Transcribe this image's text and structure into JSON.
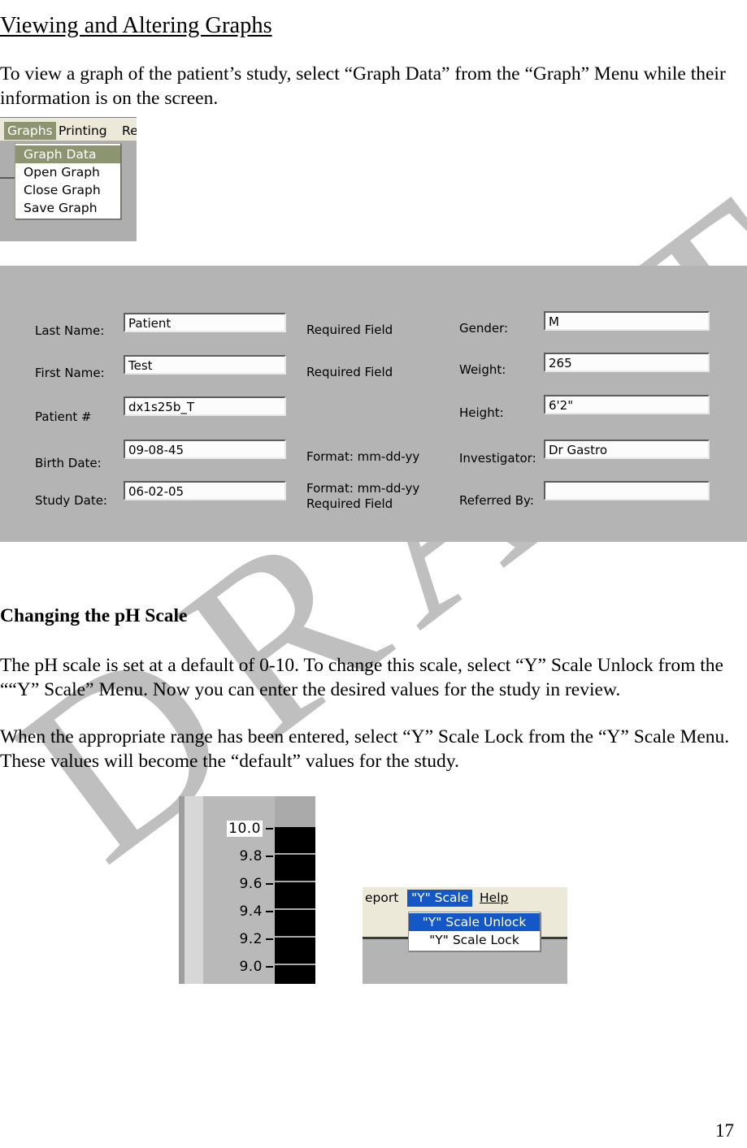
{
  "document": {
    "heading": "Viewing and Altering Graphs",
    "intro_paragraph": "To view a graph of the patient’s study, select “Graph Data” from the “Graph” Menu while their information is on the screen.",
    "section_heading": "Changing the pH Scale",
    "paragraph_2": "The pH scale is set at a default of 0-10.  To change this scale, select “Y” Scale Unlock from the ““Y” Scale” Menu.  Now you can enter the desired values for the study in review.",
    "paragraph_3": "When the appropriate range has been entered, select “Y” Scale Lock from the “Y” Scale Menu. These values will become the “default” values for the study.",
    "page_number": "17",
    "watermark": "DRAFT"
  },
  "graphs_menu": {
    "menubar": [
      {
        "label": "Graphs",
        "active": true
      },
      {
        "label": "Printing",
        "active": false
      },
      {
        "label": "Re",
        "active": false
      }
    ],
    "dropdown": [
      {
        "label": "Graph Data",
        "selected": true
      },
      {
        "label": "Open Graph",
        "selected": false
      },
      {
        "label": "Close Graph",
        "selected": false
      },
      {
        "label": "Save Graph",
        "selected": false
      }
    ],
    "highlight_color": "#8d9470",
    "menubar_color": "#ece9d8"
  },
  "patient_form": {
    "background_color": "#b4b4b4",
    "left_fields": [
      {
        "label": "Last Name:",
        "value": "Patient",
        "note": "Required Field"
      },
      {
        "label": "First Name:",
        "value": "Test",
        "note": "Required Field"
      },
      {
        "label": "Patient #",
        "value": "dx1s25b_T",
        "note": ""
      },
      {
        "label": "Birth Date:",
        "value": "09-08-45",
        "note": "Format:  mm-dd-yy"
      },
      {
        "label": "Study Date:",
        "value": "06-02-05",
        "note": "Format:  mm-dd-yy\nRequired Field"
      }
    ],
    "right_fields": [
      {
        "label": "Gender:",
        "value": "M"
      },
      {
        "label": "Weight:",
        "value": "265"
      },
      {
        "label": "Height:",
        "value": "6'2\""
      },
      {
        "label": "Investigator:",
        "value": "Dr Gastro"
      },
      {
        "label": "Referred By:",
        "value": ""
      }
    ]
  },
  "yscale_widget": {
    "ticks": [
      {
        "label": "10.0",
        "editable": true
      },
      {
        "label": "9.8",
        "editable": false
      },
      {
        "label": "9.6",
        "editable": false
      },
      {
        "label": "9.4",
        "editable": false
      },
      {
        "label": "9.2",
        "editable": false
      },
      {
        "label": "9.0",
        "editable": false
      }
    ],
    "plot_color": "#000000",
    "panel_color": "#b9b9b9"
  },
  "yscale_menu": {
    "menubar": [
      {
        "label": "eport",
        "active": false
      },
      {
        "label": "\"Y\" Scale",
        "active": true
      },
      {
        "label": "Help",
        "active": false
      }
    ],
    "dropdown": [
      {
        "label": "\"Y\" Scale Unlock",
        "selected": true
      },
      {
        "label": "\"Y\" Scale Lock",
        "selected": false
      }
    ],
    "highlight_color": "#1458c8",
    "menubar_color": "#ece9d8"
  }
}
